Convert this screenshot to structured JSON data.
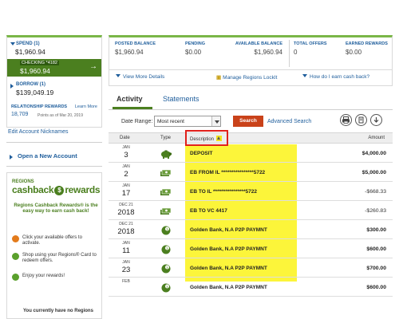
{
  "sidebar": {
    "spend_label": "SPEND (1)",
    "spend_amount": "$1,960.94",
    "checking_name": "CHECKING *4182",
    "checking_amount": "$1,960.94",
    "borrow_label": "BORROW (1)",
    "borrow_amount": "$139,049.19",
    "relationship_label": "RELATIONSHIP REWARDS",
    "learn_more": "Learn More",
    "points": "18,709",
    "points_asof": "Points as of Mar 20, 2019",
    "edit_nicknames": "Edit Account Nicknames",
    "open_account": "Open a New Account"
  },
  "cashback": {
    "brand_small": "REGIONS",
    "brand_left": "cashback",
    "brand_right": "rewards",
    "intro": "Regions Cashback Rewards® is the easy way to earn cash back!",
    "steps": [
      "Click your available offers to activate.",
      "Shop using your Regions® Card to redeem offers.",
      "Enjoy your rewards!"
    ],
    "bottom_text": "You currently have no Regions"
  },
  "summary": {
    "posted_label": "POSTED BALANCE",
    "posted_value": "$1,960.94",
    "pending_label": "PENDING",
    "pending_value": "$0.00",
    "available_label": "AVAILABLE BALANCE",
    "available_value": "$1,960.94",
    "offers_label": "TOTAL OFFERS",
    "offers_value": "0",
    "earned_label": "EARNED REWARDS",
    "earned_value": "$0.00",
    "view_more": "View More Details",
    "lockit": "Manage Regions LockIt",
    "cashback_how": "How do I earn cash back?"
  },
  "tabs": {
    "activity": "Activity",
    "statements": "Statements"
  },
  "filter": {
    "date_label": "Date Range:",
    "date_value": "Most recent",
    "search_button": "Search",
    "advanced_search": "Advanced Search"
  },
  "table": {
    "headers": {
      "date": "Date",
      "type": "Type",
      "description": "Description",
      "amount": "Amount"
    },
    "rows": [
      {
        "month": "JAN",
        "day": "3",
        "type_icon": "piggy-bank-icon",
        "description": "DEPOSIT",
        "amount": "$4,000.00"
      },
      {
        "month": "JAN",
        "day": "2",
        "type_icon": "money-transfer-icon",
        "description": "EB FROM IL ****************5722",
        "amount": "$5,000.00"
      },
      {
        "month": "JAN",
        "day": "17",
        "type_icon": "money-transfer-icon",
        "description": "EB TO IL ****************5722",
        "amount": "-$668.33"
      },
      {
        "month": "DEC 21",
        "day": "2018",
        "type_icon": "money-transfer-icon",
        "description": "EB TO VC 4417",
        "amount": "-$260.83"
      },
      {
        "month": "DEC 21",
        "day": "2018",
        "type_icon": "p2p-payment-icon",
        "description": "Golden Bank, N.A P2P PAYMNT",
        "amount": "$300.00"
      },
      {
        "month": "JAN",
        "day": "11",
        "type_icon": "p2p-payment-icon",
        "description": "Golden Bank, N.A P2P PAYMNT",
        "amount": "$600.00"
      },
      {
        "month": "JAN",
        "day": "23",
        "type_icon": "p2p-payment-icon",
        "description": "Golden Bank, N.A P2P PAYMNT",
        "amount": "$700.00"
      },
      {
        "month": "FEB",
        "day": "",
        "type_icon": "p2p-payment-icon",
        "description": "Golden Bank, N.A P2P PAYMNT",
        "amount": "$600.00"
      }
    ]
  },
  "colors": {
    "brand_green": "#4b7f1f",
    "link_blue": "#1f5e9c",
    "search_orange": "#c9421a",
    "highlight_yellow": "#fcf53a",
    "annotation_red": "#e0201b"
  }
}
